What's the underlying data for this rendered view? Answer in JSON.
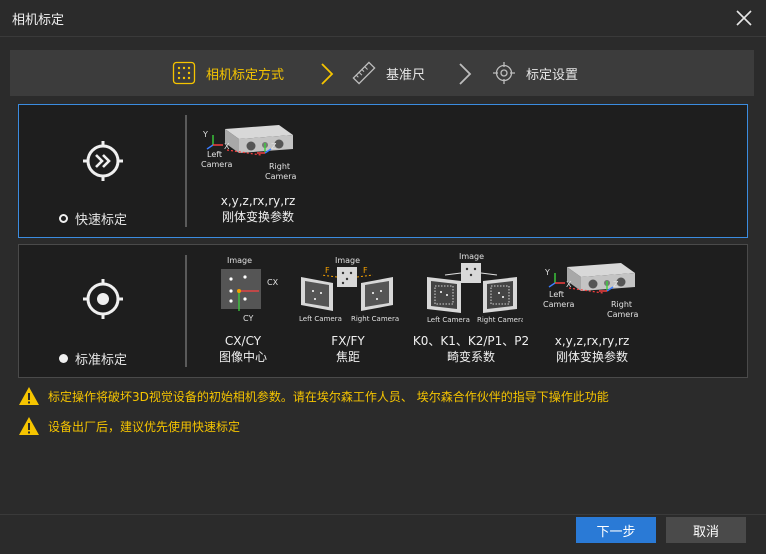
{
  "window": {
    "title": "相机标定"
  },
  "steps": [
    {
      "label": "相机标定方式",
      "active": true
    },
    {
      "label": "基准尺",
      "active": false
    },
    {
      "label": "标定设置",
      "active": false
    }
  ],
  "quick": {
    "radio_label": "快速标定",
    "item": {
      "line1": "x,y,z,rx,ry,rz",
      "line2": "刚体变换参数"
    },
    "diagram": {
      "left": "Left",
      "camera": "Camera",
      "right": "Right",
      "x": "X",
      "y": "Y",
      "z": "Z"
    }
  },
  "standard": {
    "radio_label": "标准标定",
    "items": [
      {
        "line1": "CX/CY",
        "line2": "图像中心",
        "image": "Image",
        "cx": "CX",
        "cy": "CY"
      },
      {
        "line1": "FX/FY",
        "line2": "焦距",
        "image": "Image",
        "f": "F",
        "left": "Left Camera",
        "right": "Right Camera"
      },
      {
        "line1": "K0、K1、K2/P1、P2",
        "line2": "畸变系数",
        "image": "Image",
        "left": "Left Camera",
        "right": "Right Camera"
      },
      {
        "line1": "x,y,z,rx,ry,rz",
        "line2": "刚体变换参数",
        "left": "Left",
        "camera": "Camera",
        "right": "Right",
        "x": "X",
        "y": "Y",
        "z": "Z"
      }
    ]
  },
  "warnings": [
    "标定操作将破坏3D视觉设备的初始相机参数。请在埃尔森工作人员、 埃尔森合作伙伴的指导下操作此功能",
    "设备出厂后，建议优先使用快速标定"
  ],
  "buttons": {
    "next": "下一步",
    "cancel": "取消"
  },
  "colors": {
    "accent": "#f5c400",
    "primary": "#2a7ad6",
    "selected_border": "#3b8ce0"
  }
}
